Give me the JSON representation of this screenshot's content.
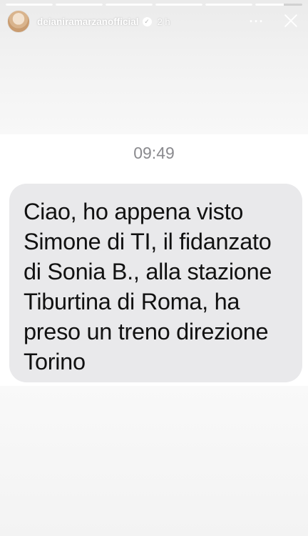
{
  "story": {
    "progress_segments": [
      1,
      1,
      1,
      1,
      1,
      0.6
    ],
    "header": {
      "username": "deianiramarzanofficial",
      "verified_icon": "verified-badge-icon",
      "time_ago": "2 h",
      "more_icon": "more-options-icon",
      "more_glyph": "···",
      "close_icon": "close-icon"
    },
    "message": {
      "timestamp": "09:49",
      "text": "Ciao, ho appena visto Simone di TI, il fidanzato di Sonia B., alla stazione Tiburtina di Roma, ha preso un treno direzione Torino"
    },
    "colors": {
      "bubble": "#e9e9eb",
      "timestamp": "#8a8a8e",
      "background": "#f6f6f6"
    }
  }
}
